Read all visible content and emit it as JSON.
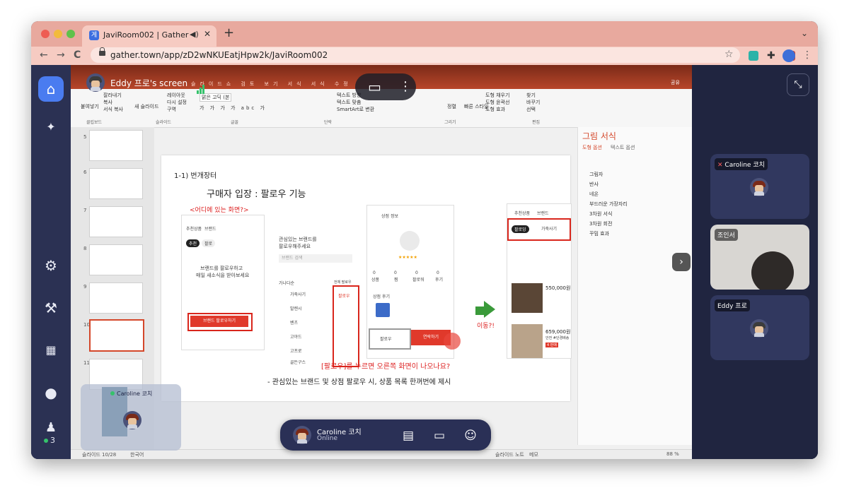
{
  "browser": {
    "tab_title": "JaviRoom002 | Gather",
    "tab_favicon": "게",
    "new_tab": "+",
    "tab_sound": "◀)",
    "tab_close": "✕",
    "tab_menu": "⌄",
    "url": "gather.town/app/zD2wNKUEatjHpw2k/JaviRoom002",
    "back": "←",
    "forward": "→",
    "reload": "C",
    "bookmark_star": "☆"
  },
  "sidebar": {
    "home": "⌂",
    "pin": "📌",
    "settings": "⚙",
    "build": "🔨",
    "calendar": "📅",
    "chat": "💬",
    "people": "👥",
    "online_count": "3"
  },
  "screen_share": {
    "title": "Eddy 프로's screen",
    "monitor_icon": "▭",
    "more_icon": "⋮"
  },
  "ppt": {
    "ribbon_tabs": "슬라이드쇼 검토 보기 서식 서식 수정",
    "share_btn": "공유",
    "ribbon_groups": [
      "클립보드",
      "슬라이드",
      "글꼴",
      "단락",
      "그리기",
      "편집"
    ],
    "ribbon_items": {
      "paste": "붙여넣기",
      "cut": "잘라내기",
      "copy": "복사",
      "format_copy": "서식 복사",
      "new_slide": "새 슬라이드",
      "layout": "레이아웃",
      "reset": "다시 설정",
      "section": "구역",
      "font": "맑은 고딕 (본",
      "smartart": "SmartArt로 변환",
      "text_dir": "텍스트 방향",
      "text_align": "텍스트 맞춤",
      "arrange": "정렬",
      "quick_style": "빠른 스타일",
      "fill": "도형 채우기",
      "outline": "도형 윤곽선",
      "effect": "도형 효과",
      "find": "찾기",
      "replace": "바꾸기",
      "select": "선택"
    },
    "thumbnails": [
      "5",
      "6",
      "7",
      "8",
      "9",
      "10",
      "11"
    ],
    "slide": {
      "section_title": "1-1) 번개장터",
      "main_title": "구매자 입장 : 팔로우 기능",
      "question1": "<어디에 있는 화면?>",
      "phone1_tabs": [
        "추천상품",
        "브랜드"
      ],
      "phone1_chips": [
        "추천",
        "팔로"
      ],
      "phone1_msg1": "브랜드를 팔로우하고",
      "phone1_msg2": "매일 새소식을 받아보세요",
      "phone1_btn": "브랜드 팔로우하기",
      "phone2_title1": "관심있는 브랜드를",
      "phone2_title2": "팔로우해주세요",
      "phone2_search": "브랜드 검색",
      "phone2_sort": "가나다순",
      "phone2_list_head": "전체 팔로우",
      "phone2_brands": [
        "가죽사기",
        "발렌시",
        "벤츠",
        "고야드",
        "고프로",
        "골든구스"
      ],
      "phone2_follow": "팔로우",
      "phone3_title": "상점 정보",
      "phone3_section": "상점 후기",
      "phone3_stat_labels": [
        "상품",
        "찜",
        "팔로워",
        "후기"
      ],
      "phone3_stats": [
        "0",
        "0",
        "0",
        "0"
      ],
      "phone3_rating": "★★★★★",
      "phone3_followers": "팔로우",
      "phone3_btn": "연락하기",
      "move_label": "이동?!",
      "phone4_tabs": [
        "추천상품",
        "브랜드"
      ],
      "phone4_chip": "팔로잉",
      "phone4_chip2": "가죽사기",
      "prices": [
        "550,000원",
        "659,000원"
      ],
      "price_desc": "안전 #단경배송",
      "badge": "4 판매",
      "question2": "[팔로우]를 누르면 오른쪽 화면이 나오나요?",
      "desc": "- 관심있는 브랜드 및 상점 팔로우 시, 상품 목록 한꺼번에 제시"
    },
    "format_pane": {
      "title": "그림 서식",
      "tab1": "도형 옵션",
      "tab2": "텍스트 옵션",
      "items": [
        "그림자",
        "반사",
        "네온",
        "부드러운 가장자리",
        "3차원 서식",
        "3차원 회전",
        "꾸밈 효과"
      ]
    },
    "status": {
      "slide_count": "슬라이드 10/28",
      "language": "한국어",
      "notes": "슬라이드 노트",
      "memo": "메모",
      "zoom": "88 %"
    }
  },
  "participants": [
    {
      "name": "Caroline 코치",
      "muted": true
    },
    {
      "name": "조인서",
      "muted": false
    },
    {
      "name": "Eddy 프로",
      "muted": false
    }
  ],
  "minimap": {
    "label": "Caroline 코치"
  },
  "bottom_bar": {
    "name": "Caroline 코치",
    "status": "Online",
    "map_icon": "🗺",
    "screen_icon": "🖵",
    "emoji_icon": "☺"
  },
  "colors": {
    "accent": "#4a7cf0",
    "online": "#35c26b",
    "ppt_brand": "#b8462a",
    "highlight_red": "#d9261c"
  }
}
